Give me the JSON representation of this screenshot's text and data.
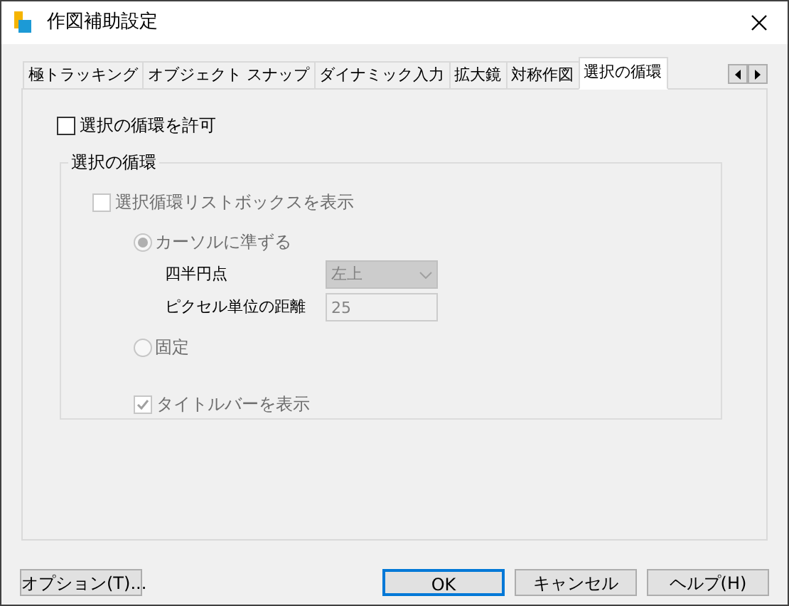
{
  "window": {
    "title": "作図補助設定"
  },
  "tabs": [
    {
      "label": "極トラッキング",
      "selected": false
    },
    {
      "label": "オブジェクト スナップ",
      "selected": false
    },
    {
      "label": "ダイナミック入力",
      "selected": false
    },
    {
      "label": "拡大鏡",
      "selected": false
    },
    {
      "label": "対称作図",
      "selected": false
    },
    {
      "label": "選択の循環",
      "selected": true
    }
  ],
  "allow_cycling": {
    "label": "選択の循環を許可",
    "checked": false
  },
  "group": {
    "title": "選択の循環",
    "show_listbox": {
      "label": "選択循環リストボックスを表示",
      "checked": false,
      "disabled": true
    },
    "placement": [
      {
        "label": "カーソルに準ずる",
        "selected": true,
        "disabled": true
      },
      {
        "label": "固定",
        "selected": false,
        "disabled": true
      }
    ],
    "quadrant": {
      "label": "四半円点",
      "value": "左上",
      "disabled": true
    },
    "distance": {
      "label": "ピクセル単位の距離",
      "value": "25",
      "disabled": true
    },
    "show_titlebar": {
      "label": "タイトルバーを表示",
      "checked": true,
      "disabled": true
    }
  },
  "buttons": [
    {
      "label": "オプション(T)...",
      "default": false
    },
    {
      "label": "OK",
      "default": true
    },
    {
      "label": "キャンセル",
      "default": false
    },
    {
      "label": "ヘルプ(H)",
      "default": false
    }
  ]
}
